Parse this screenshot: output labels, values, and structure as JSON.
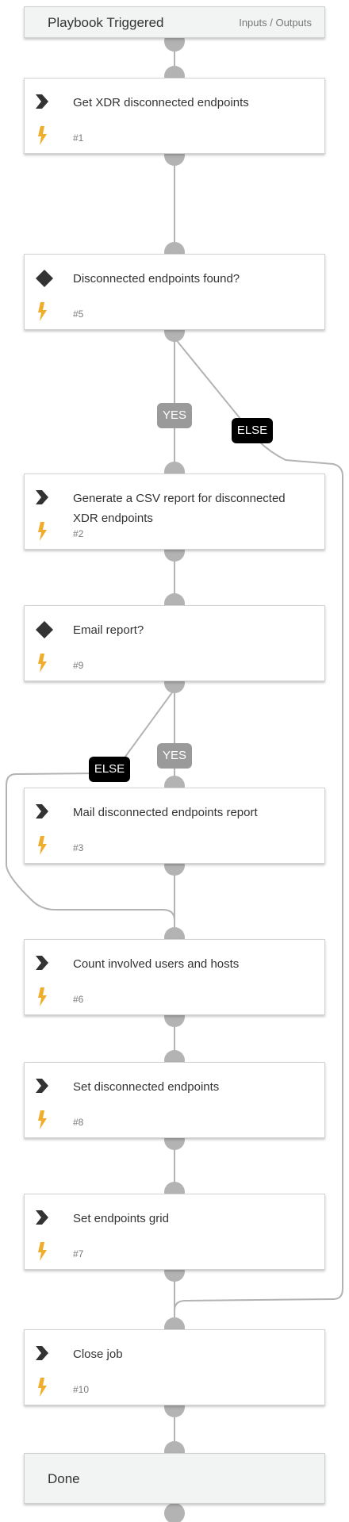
{
  "header": {
    "title": "Playbook Triggered",
    "io_label": "Inputs / Outputs"
  },
  "tasks": [
    {
      "id": "get-xdr",
      "title": "Get XDR disconnected endpoints",
      "number": "#1",
      "type": "command"
    },
    {
      "id": "disconnected-found",
      "title": "Disconnected endpoints found?",
      "number": "#5",
      "type": "condition"
    },
    {
      "id": "generate-csv",
      "title": "Generate a CSV report for disconnected XDR endpoints",
      "number": "#2",
      "type": "command"
    },
    {
      "id": "email-report",
      "title": "Email report?",
      "number": "#9",
      "type": "condition"
    },
    {
      "id": "mail-report",
      "title": "Mail disconnected endpoints report",
      "number": "#3",
      "type": "command"
    },
    {
      "id": "count-users",
      "title": "Count involved users and hosts",
      "number": "#6",
      "type": "command"
    },
    {
      "id": "set-disconnected",
      "title": "Set disconnected endpoints",
      "number": "#8",
      "type": "command"
    },
    {
      "id": "set-grid",
      "title": "Set endpoints grid",
      "number": "#7",
      "type": "command"
    },
    {
      "id": "close-job",
      "title": "Close job",
      "number": "#10",
      "type": "command"
    }
  ],
  "footer": {
    "title": "Done"
  },
  "branches": {
    "yes": "YES",
    "else": "ELSE"
  },
  "colors": {
    "connector": "#b3b3b3",
    "bolt": "#f0ad2b",
    "icon": "#333333",
    "yes_badge": "#9a9a9a",
    "else_badge": "#000000"
  },
  "icons": {
    "command": "chevron-icon",
    "condition": "diamond-icon",
    "trigger": "bolt-icon"
  }
}
